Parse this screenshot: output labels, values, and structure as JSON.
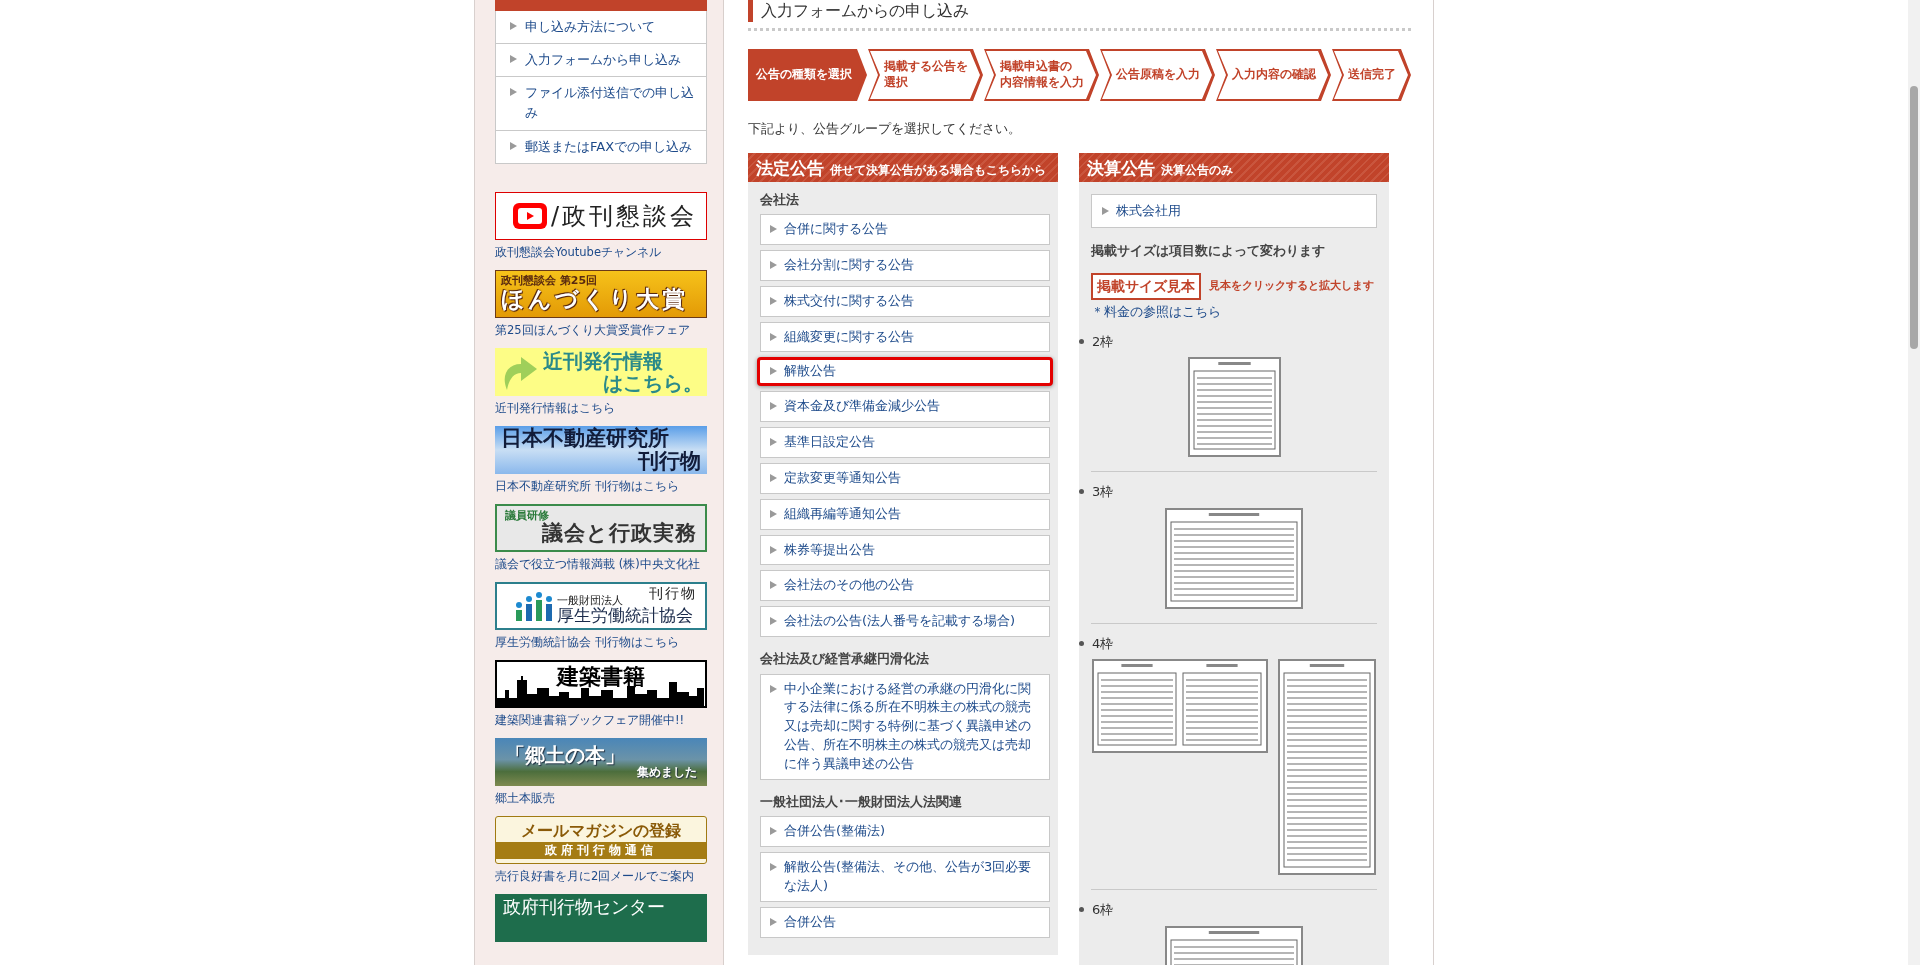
{
  "sidebar": {
    "menu": [
      {
        "label": "申し込み方法について"
      },
      {
        "label": "入力フォームから申し込み"
      },
      {
        "label": "ファイル添付送信での申し込み"
      },
      {
        "label": "郵送またはFAXでの申し込み"
      }
    ],
    "banners": [
      {
        "kind": "youtube",
        "lines": [
          "/政刊懇談会"
        ],
        "caption": "政刊懇談会Youtubeチャンネル"
      },
      {
        "kind": "hondukuri",
        "lines": [
          "政刊懇談会 第25回",
          "ほんづくり大賞"
        ],
        "caption": "第25回ほんづくり大賞受賞作フェア"
      },
      {
        "kind": "kinkan",
        "lines": [
          "近刊発行情報",
          "はこちら。"
        ],
        "caption": "近刊発行情報はこちら"
      },
      {
        "kind": "fudosan",
        "lines": [
          "日本不動産研究所",
          "刊行物"
        ],
        "caption": "日本不動産研究所 刊行物はこちら"
      },
      {
        "kind": "gikai",
        "lines": [
          "議員研修",
          "議会と行政実務"
        ],
        "caption": "議会で役立つ情報満載 (株)中央文化社"
      },
      {
        "kind": "kosei",
        "lines": [
          "一般財団法人",
          "刊行物",
          "厚生労働統計協会"
        ],
        "caption": "厚生労働統計協会 刊行物はこちら"
      },
      {
        "kind": "kenchiku",
        "lines": [
          "建築書籍"
        ],
        "caption": "建築関連書籍ブックフェア開催中!!"
      },
      {
        "kind": "kyodo",
        "lines": [
          "「郷土の本」",
          "集めました"
        ],
        "caption": "郷土本販売"
      },
      {
        "kind": "mailmag",
        "lines": [
          "メールマガジンの登録",
          "政府刊行物通信"
        ],
        "caption": "売行良好書を月に2回メールでご案内"
      },
      {
        "kind": "center",
        "lines": [
          "政府刊行物センター"
        ]
      }
    ]
  },
  "main": {
    "title": "入力フォームからの申し込み",
    "steps": [
      {
        "lines": [
          "公告の種類を選択"
        ],
        "current": true
      },
      {
        "lines": [
          "掲載する公告を",
          "選択"
        ],
        "current": false
      },
      {
        "lines": [
          "掲載申込書の",
          "内容情報を入力"
        ],
        "current": false
      },
      {
        "lines": [
          "公告原稿を入力"
        ],
        "current": false
      },
      {
        "lines": [
          "入力内容の確認"
        ],
        "current": false
      },
      {
        "lines": [
          "送信完了"
        ],
        "current": false
      }
    ],
    "instruction": "下記より、公告グループを選択してください。",
    "statutory_panel": {
      "title": "法定公告",
      "subtitle": "併せて決算公告がある場合もこちらから",
      "groups": [
        {
          "heading": "会社法",
          "items": [
            {
              "label": "合併に関する公告",
              "highlighted": false
            },
            {
              "label": "会社分割に関する公告",
              "highlighted": false
            },
            {
              "label": "株式交付に関する公告",
              "highlighted": false
            },
            {
              "label": "組織変更に関する公告",
              "highlighted": false
            },
            {
              "label": "解散公告",
              "highlighted": true
            },
            {
              "label": "資本金及び準備金減少公告",
              "highlighted": false
            },
            {
              "label": "基準日設定公告",
              "highlighted": false
            },
            {
              "label": "定款変更等通知公告",
              "highlighted": false
            },
            {
              "label": "組織再編等通知公告",
              "highlighted": false
            },
            {
              "label": "株券等提出公告",
              "highlighted": false
            },
            {
              "label": "会社法のその他の公告",
              "highlighted": false
            },
            {
              "label": "会社法の公告(法人番号を記載する場合)",
              "highlighted": false
            }
          ]
        },
        {
          "heading": "会社法及び経営承継円滑化法",
          "items": [
            {
              "label": "中小企業における経営の承継の円滑化に関する法律に係る所在不明株主の株式の競売又は売却に関する特例に基づく異議申述の公告、所在不明株主の株式の競売又は売却に伴う異議申述の公告",
              "highlighted": false
            }
          ]
        },
        {
          "heading": "一般社団法人･一般財団法人法関連",
          "items": [
            {
              "label": "合併公告(整備法)",
              "highlighted": false
            },
            {
              "label": "解散公告(整備法、その他、公告が3回必要な法人)",
              "highlighted": false
            },
            {
              "label": "合併公告",
              "highlighted": false
            }
          ]
        }
      ]
    },
    "settlement_panel": {
      "title": "決算公告",
      "subtitle": "決算公告のみ",
      "items": [
        {
          "label": "株式会社用"
        }
      ],
      "size_note": "掲載サイズは項目数によって変わります",
      "sample_button": "掲載サイズ見本",
      "sample_hint": "見本をクリックすると拡大します",
      "fee_link": "＊料金の参照はこちら",
      "sizes": [
        {
          "label": "2枠",
          "thumbnails": [
            {
              "kind": "square"
            }
          ]
        },
        {
          "label": "3枠",
          "thumbnails": [
            {
              "kind": "wide"
            }
          ]
        },
        {
          "label": "4枠",
          "thumbnails": [
            {
              "kind": "broad"
            },
            {
              "kind": "tall"
            }
          ]
        },
        {
          "label": "6枠",
          "thumbnails": [
            {
              "kind": "wide"
            }
          ]
        }
      ]
    }
  }
}
